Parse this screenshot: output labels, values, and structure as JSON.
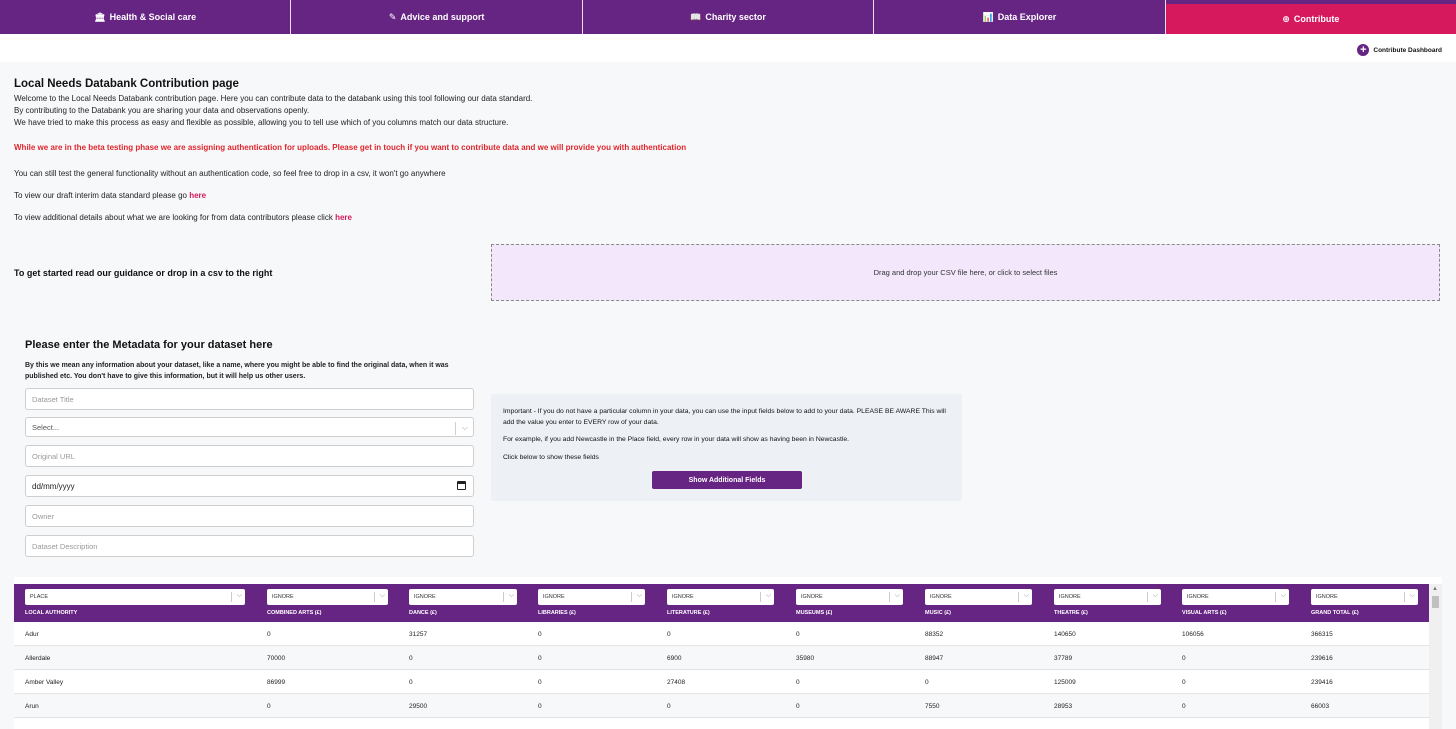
{
  "nav": {
    "items": [
      {
        "icon": "🏛",
        "label": "Health & Social care"
      },
      {
        "icon": "✎",
        "label": "Advice and support"
      },
      {
        "icon": "📖",
        "label": "Charity sector"
      },
      {
        "icon": "📊",
        "label": "Data Explorer"
      },
      {
        "icon": "⊕",
        "label": "Contribute"
      }
    ]
  },
  "contribute_dashboard": "Contribute Dashboard",
  "intro": {
    "title": "Local Needs Databank Contribution page",
    "lines": [
      "Welcome to the Local Needs Databank contribution page. Here you can contribute data to the databank using this tool following our data standard.",
      "By contributing to the Databank you are sharing your data and observations openly.",
      "We have tried to make this process as easy and flexible as possible, allowing you to tell use which of you columns match our data structure."
    ],
    "warning": "While we are in the beta testing phase we are assigning authentication for uploads. Please get in touch if you want to contribute data and we will provide you with authentication",
    "test_note": "You can still test the general functionality without an authentication code, so feel free to drop in a csv, it won't go anywhere",
    "standard_prefix": "To view our draft interim data standard please go ",
    "standard_link": "here",
    "details_prefix": "To view additional details about what we are looking for from data contributors please click ",
    "details_link": "here"
  },
  "get_started": "To get started read our guidance or drop in a csv to the right",
  "dropzone": "Drag and drop your CSV file here, or click to select files",
  "metadata": {
    "title": "Please enter the Metadata for your dataset here",
    "description": "By this we mean any information about your dataset, like a name, where you might be able to find the original data, when it was published etc. You don't have to give this information, but it will help us other users.",
    "fields": {
      "dataset_title_placeholder": "Dataset Title",
      "select_placeholder": "Select...",
      "original_url_placeholder": "Original URL",
      "date_value": "dd/mm/yyyy",
      "owner_placeholder": "Owner",
      "description_placeholder": "Dataset Description"
    }
  },
  "info_box": {
    "p1": "Important - If you do not have a particular column in your data, you can use the input fields below to add to your data. PLEASE BE AWARE This will add the value you enter to EVERY row of your data.",
    "p2": "For example, if you add Newcastle in the Place field, every row in your data will show as having been in Newcastle.",
    "p3": "Click below to show these fields",
    "button": "Show Additional Fields"
  },
  "table": {
    "columns": [
      {
        "select": "PLACE",
        "header": "LOCAL AUTHORITY"
      },
      {
        "select": "IGNORE",
        "header": "COMBINED ARTS (£)"
      },
      {
        "select": "IGNORE",
        "header": "DANCE (£)"
      },
      {
        "select": "IGNORE",
        "header": "LIBRARIES (£)"
      },
      {
        "select": "IGNORE",
        "header": "LITERATURE (£)"
      },
      {
        "select": "IGNORE",
        "header": "MUSEUMS (£)"
      },
      {
        "select": "IGNORE",
        "header": "MUSIC (£)"
      },
      {
        "select": "IGNORE",
        "header": "THEATRE (£)"
      },
      {
        "select": "IGNORE",
        "header": "VISUAL ARTS (£)"
      },
      {
        "select": "IGNORE",
        "header": "GRAND TOTAL (£)"
      }
    ],
    "rows": [
      [
        "Adur",
        "0",
        "31257",
        "0",
        "0",
        "0",
        "88352",
        "140650",
        "106056",
        "366315"
      ],
      [
        "Allerdale",
        "70000",
        "0",
        "0",
        "6900",
        "35980",
        "88947",
        "37789",
        "0",
        "239616"
      ],
      [
        "Amber Valley",
        "86999",
        "0",
        "0",
        "27408",
        "0",
        "0",
        "125009",
        "0",
        "239416"
      ],
      [
        "Arun",
        "0",
        "29500",
        "0",
        "0",
        "0",
        "7550",
        "28953",
        "0",
        "66003"
      ]
    ]
  }
}
